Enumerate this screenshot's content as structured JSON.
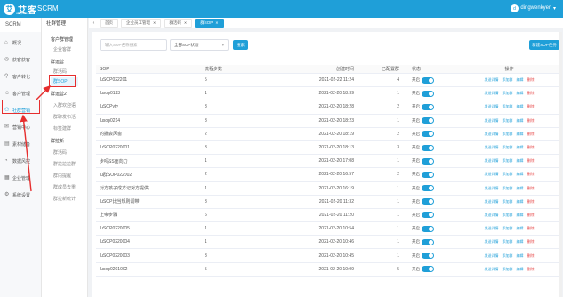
{
  "topbar": {
    "logo_mark": "艾",
    "logo_text": "艾客",
    "logo_sub": "aikeyun.com",
    "app_title": "SCRM",
    "user": "dingwenkyer",
    "avatar": "d"
  },
  "side1": {
    "title": "SCRM",
    "items": [
      {
        "label": "概况",
        "icon": "home-icon",
        "glyph": "⌂"
      },
      {
        "label": "获客获客",
        "icon": "magnet-icon",
        "glyph": "◎"
      },
      {
        "label": "客户转化",
        "icon": "funnel-icon",
        "glyph": "⚲"
      },
      {
        "label": "客户管理",
        "icon": "users-icon",
        "glyph": "☺"
      },
      {
        "label": "社群营销",
        "icon": "group-icon",
        "glyph": "⚇"
      },
      {
        "label": "营销中心",
        "icon": "megaphone-icon",
        "glyph": "✉"
      },
      {
        "label": "素材储备",
        "icon": "folder-icon",
        "glyph": "▤"
      },
      {
        "label": "数据风控",
        "icon": "chart-icon",
        "glyph": "◔"
      },
      {
        "label": "企业管理",
        "icon": "building-icon",
        "glyph": "▦"
      },
      {
        "label": "系统设置",
        "icon": "gear-icon",
        "glyph": "⚙"
      }
    ]
  },
  "side2": {
    "title": "社群管理",
    "groups": [
      {
        "label": "客户群管理",
        "subs": [
          "企业客群"
        ]
      },
      {
        "label": "群运营",
        "subs": [
          "群活码",
          "群SOP"
        ]
      },
      {
        "label": "群运营2",
        "subs": [
          "入群欢迎语",
          "群聊发布活",
          "标签建群"
        ]
      },
      {
        "label": "群拉新",
        "subs": [
          "群活码",
          "群拉拉拉群",
          "群内提醒",
          "群成员去重",
          "群拉新统计"
        ]
      }
    ]
  },
  "tabs": {
    "items": [
      {
        "label": "首页",
        "active": false
      },
      {
        "label": "企业员工管理",
        "active": false
      },
      {
        "label": "群活码",
        "active": false
      },
      {
        "label": "群SOP",
        "active": true
      }
    ]
  },
  "filters": {
    "search_placeholder": "输入SOP名称搜索",
    "status_value": "全部SOP状态",
    "search_button": "搜索",
    "create_button": "新建SOP任务"
  },
  "table": {
    "headers": [
      "SOP",
      "流程步数",
      "创建时间",
      "已配置群",
      "状态",
      "操作"
    ],
    "switch_label": "开启",
    "ops": [
      "发送详情",
      "添加群",
      "编辑",
      "删除"
    ],
    "rows": [
      {
        "name": "luSOP022201",
        "steps": "5",
        "time": "2021-02-22 11:24",
        "groups": "4"
      },
      {
        "name": "lusop0123",
        "steps": "1",
        "time": "2021-02-20 18:39",
        "groups": "1"
      },
      {
        "name": "luSOPyty",
        "steps": "3",
        "time": "2021-02-20 18:28",
        "groups": "2"
      },
      {
        "name": "lusop0214",
        "steps": "3",
        "time": "2021-02-20 18:23",
        "groups": "1"
      },
      {
        "name": "的撒会风窗",
        "steps": "2",
        "time": "2021-02-20 18:19",
        "groups": "2"
      },
      {
        "name": "luSOP0220001",
        "steps": "3",
        "time": "2021-02-20 18:13",
        "groups": "3"
      },
      {
        "name": "步吗SS面向力",
        "steps": "1",
        "time": "2021-02-20 17:08",
        "groups": "1"
      },
      {
        "name": "lu群SOP022002",
        "steps": "2",
        "time": "2021-02-20 16:57",
        "groups": "2"
      },
      {
        "name": "对方孩子成方记对方提供",
        "steps": "1",
        "time": "2021-02-20 16:19",
        "groups": "1"
      },
      {
        "name": "luSOP比当规则调带",
        "steps": "3",
        "time": "2021-02-20 11:32",
        "groups": "1"
      },
      {
        "name": "上帝步骤",
        "steps": "6",
        "time": "2021-02-20 11:20",
        "groups": "1"
      },
      {
        "name": "luSOP0220005",
        "steps": "1",
        "time": "2021-02-20 10:54",
        "groups": "1"
      },
      {
        "name": "luSOP0220004",
        "steps": "1",
        "time": "2021-02-20 10:46",
        "groups": "1"
      },
      {
        "name": "luSOP0220003",
        "steps": "3",
        "time": "2021-02-20 10:45",
        "groups": "1"
      },
      {
        "name": "lusop0201002",
        "steps": "5",
        "time": "2021-02-20 10:09",
        "groups": "5"
      }
    ]
  },
  "colors": {
    "brand": "#1f9fd8",
    "annotation": "#e62e2e",
    "danger": "#e64545"
  }
}
